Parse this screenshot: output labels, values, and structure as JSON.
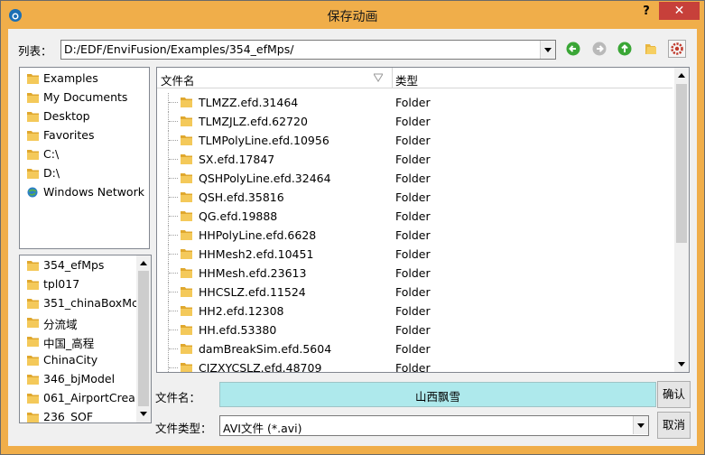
{
  "window": {
    "title": "保存动画",
    "help_label": "?",
    "close_label": "✕",
    "accent_color": "#f0ae4a"
  },
  "lookin": {
    "label": "列表：",
    "path": "D:/EDF/EnviFusion/Examples/354_efMps/"
  },
  "toolbar": {
    "icons": [
      "back-icon",
      "forward-icon",
      "up-icon",
      "new-folder-icon",
      "settings-icon"
    ]
  },
  "sidebar": {
    "items": [
      {
        "label": "Examples",
        "icon": "folder-icon"
      },
      {
        "label": "My Documents",
        "icon": "folder-icon"
      },
      {
        "label": "Desktop",
        "icon": "folder-icon"
      },
      {
        "label": "Favorites",
        "icon": "folder-icon"
      },
      {
        "label": "C:\\",
        "icon": "folder-icon"
      },
      {
        "label": "D:\\",
        "icon": "folder-icon"
      },
      {
        "label": "Windows Network",
        "icon": "network-icon"
      }
    ]
  },
  "history": {
    "items": [
      {
        "label": "354_efMps"
      },
      {
        "label": "tpl017"
      },
      {
        "label": "351_chinaBoxMc"
      },
      {
        "label": "分流域"
      },
      {
        "label": "中国_高程"
      },
      {
        "label": "ChinaCity"
      },
      {
        "label": "346_bjModel"
      },
      {
        "label": "061_AirportCrea"
      },
      {
        "label": "236_SOF"
      }
    ]
  },
  "filelist": {
    "columns": {
      "name": "文件名",
      "type": "类型"
    },
    "rows": [
      {
        "name": "TLMZZ.efd.31464",
        "type": "Folder"
      },
      {
        "name": "TLMZJLZ.efd.62720",
        "type": "Folder"
      },
      {
        "name": "TLMPolyLine.efd.10956",
        "type": "Folder"
      },
      {
        "name": "SX.efd.17847",
        "type": "Folder"
      },
      {
        "name": "QSHPolyLine.efd.32464",
        "type": "Folder"
      },
      {
        "name": "QSH.efd.35816",
        "type": "Folder"
      },
      {
        "name": "QG.efd.19888",
        "type": "Folder"
      },
      {
        "name": "HHPolyLine.efd.6628",
        "type": "Folder"
      },
      {
        "name": "HHMesh2.efd.10451",
        "type": "Folder"
      },
      {
        "name": "HHMesh.efd.23613",
        "type": "Folder"
      },
      {
        "name": "HHCSLZ.efd.11524",
        "type": "Folder"
      },
      {
        "name": "HH2.efd.12308",
        "type": "Folder"
      },
      {
        "name": "HH.efd.53380",
        "type": "Folder"
      },
      {
        "name": "damBreakSim.efd.5604",
        "type": "Folder"
      },
      {
        "name": "CJZXYCSLZ.efd.48709",
        "type": "Folder"
      }
    ]
  },
  "filename": {
    "label": "文件名：",
    "value": "山西飘雪"
  },
  "filetype": {
    "label": "文件类型：",
    "value": "AVI文件 (*.avi)"
  },
  "buttons": {
    "confirm": "确认",
    "cancel": "取消"
  }
}
